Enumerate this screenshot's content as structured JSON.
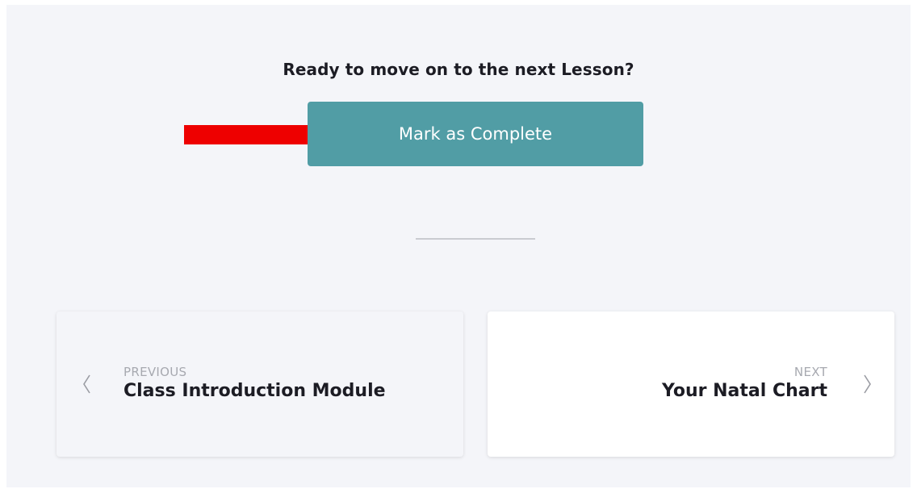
{
  "lesson_footer": {
    "prompt": "Ready to move on to the next Lesson?",
    "complete_button_label": "Mark as Complete"
  },
  "navigation": {
    "previous": {
      "kicker": "PREVIOUS",
      "title": "Class Introduction Module",
      "icon": "chevron-left-icon"
    },
    "next": {
      "kicker": "NEXT",
      "title": "Your Natal Chart",
      "icon": "chevron-right-icon"
    }
  },
  "colors": {
    "accent": "#519da5",
    "annotation_arrow": "#ff0000",
    "background": "#f4f5f9"
  }
}
